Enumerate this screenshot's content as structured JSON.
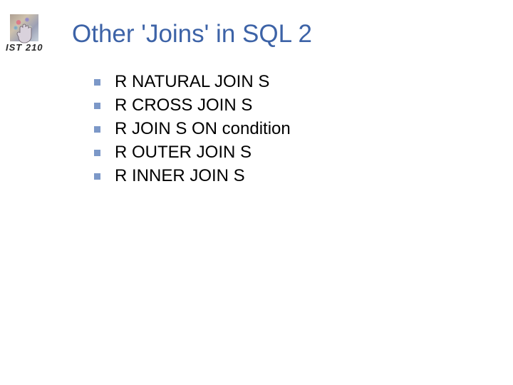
{
  "logo": {
    "label": "IST 210"
  },
  "title": "Other 'Joins' in SQL 2",
  "bullets": [
    "R NATURAL JOIN S",
    "R CROSS JOIN S",
    "R JOIN S ON condition",
    "R OUTER JOIN S",
    "R INNER JOIN S"
  ]
}
